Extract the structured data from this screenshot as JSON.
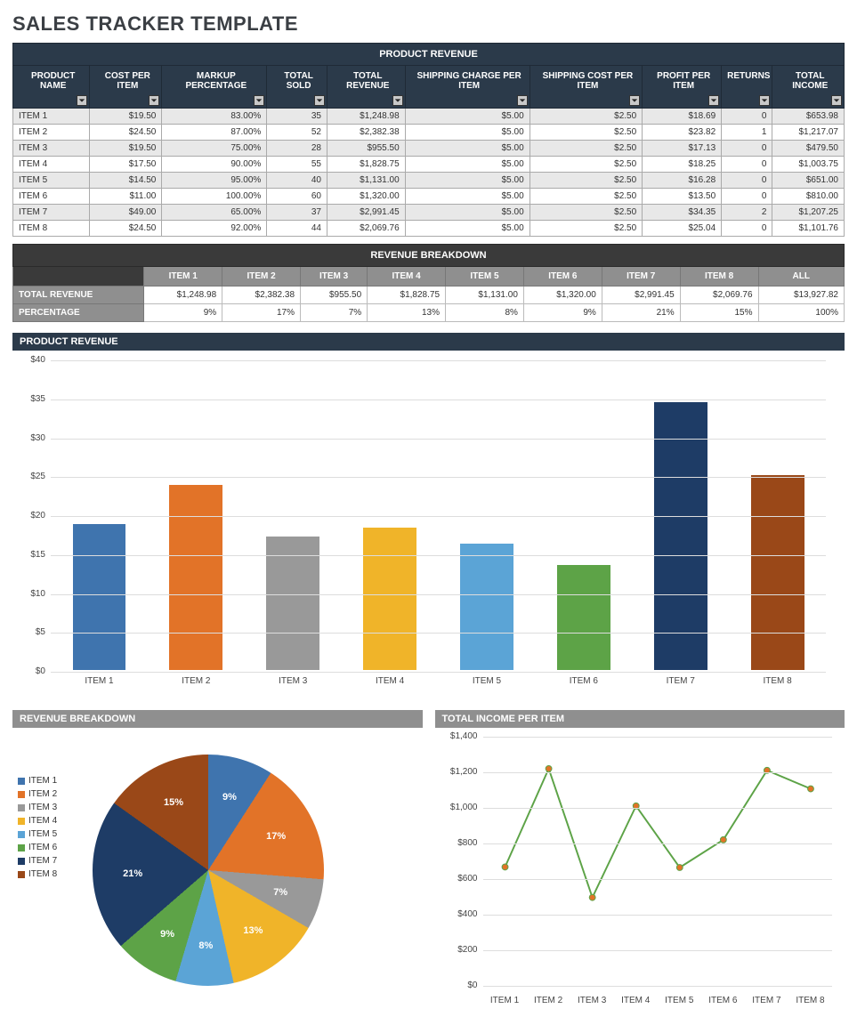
{
  "page_title": "SALES TRACKER TEMPLATE",
  "product_table": {
    "super_header": "PRODUCT REVENUE",
    "columns": [
      "PRODUCT NAME",
      "COST PER ITEM",
      "MARKUP PERCENTAGE",
      "TOTAL SOLD",
      "TOTAL REVENUE",
      "SHIPPING CHARGE PER ITEM",
      "SHIPPING COST PER ITEM",
      "PROFIT PER ITEM",
      "RETURNS",
      "TOTAL INCOME"
    ],
    "rows": [
      {
        "name": "ITEM 1",
        "cost": "$19.50",
        "markup": "83.00%",
        "sold": "35",
        "revenue": "$1,248.98",
        "shipcharge": "$5.00",
        "shipcost": "$2.50",
        "profit": "$18.69",
        "returns": "0",
        "income": "$653.98"
      },
      {
        "name": "ITEM 2",
        "cost": "$24.50",
        "markup": "87.00%",
        "sold": "52",
        "revenue": "$2,382.38",
        "shipcharge": "$5.00",
        "shipcost": "$2.50",
        "profit": "$23.82",
        "returns": "1",
        "income": "$1,217.07"
      },
      {
        "name": "ITEM 3",
        "cost": "$19.50",
        "markup": "75.00%",
        "sold": "28",
        "revenue": "$955.50",
        "shipcharge": "$5.00",
        "shipcost": "$2.50",
        "profit": "$17.13",
        "returns": "0",
        "income": "$479.50"
      },
      {
        "name": "ITEM 4",
        "cost": "$17.50",
        "markup": "90.00%",
        "sold": "55",
        "revenue": "$1,828.75",
        "shipcharge": "$5.00",
        "shipcost": "$2.50",
        "profit": "$18.25",
        "returns": "0",
        "income": "$1,003.75"
      },
      {
        "name": "ITEM 5",
        "cost": "$14.50",
        "markup": "95.00%",
        "sold": "40",
        "revenue": "$1,131.00",
        "shipcharge": "$5.00",
        "shipcost": "$2.50",
        "profit": "$16.28",
        "returns": "0",
        "income": "$651.00"
      },
      {
        "name": "ITEM 6",
        "cost": "$11.00",
        "markup": "100.00%",
        "sold": "60",
        "revenue": "$1,320.00",
        "shipcharge": "$5.00",
        "shipcost": "$2.50",
        "profit": "$13.50",
        "returns": "0",
        "income": "$810.00"
      },
      {
        "name": "ITEM 7",
        "cost": "$49.00",
        "markup": "65.00%",
        "sold": "37",
        "revenue": "$2,991.45",
        "shipcharge": "$5.00",
        "shipcost": "$2.50",
        "profit": "$34.35",
        "returns": "2",
        "income": "$1,207.25"
      },
      {
        "name": "ITEM 8",
        "cost": "$24.50",
        "markup": "92.00%",
        "sold": "44",
        "revenue": "$2,069.76",
        "shipcharge": "$5.00",
        "shipcost": "$2.50",
        "profit": "$25.04",
        "returns": "0",
        "income": "$1,101.76"
      }
    ]
  },
  "breakdown_table": {
    "super_header": "REVENUE BREAKDOWN",
    "columns": [
      "",
      "ITEM 1",
      "ITEM 2",
      "ITEM 3",
      "ITEM 4",
      "ITEM 5",
      "ITEM 6",
      "ITEM 7",
      "ITEM 8",
      "ALL"
    ],
    "rows": [
      {
        "label": "TOTAL REVENUE",
        "cells": [
          "$1,248.98",
          "$2,382.38",
          "$955.50",
          "$1,828.75",
          "$1,131.00",
          "$1,320.00",
          "$2,991.45",
          "$2,069.76",
          "$13,927.82"
        ]
      },
      {
        "label": "PERCENTAGE",
        "cells": [
          "9%",
          "17%",
          "7%",
          "13%",
          "8%",
          "9%",
          "21%",
          "15%",
          "100%"
        ]
      }
    ]
  },
  "bar_chart": {
    "title": "PRODUCT REVENUE",
    "yticks": [
      "$0",
      "$5",
      "$10",
      "$15",
      "$20",
      "$25",
      "$30",
      "$35",
      "$40"
    ],
    "categories": [
      "ITEM 1",
      "ITEM 2",
      "ITEM 3",
      "ITEM 4",
      "ITEM 5",
      "ITEM 6",
      "ITEM 7",
      "ITEM 8"
    ]
  },
  "pie_chart": {
    "title": "REVENUE BREAKDOWN",
    "legend": [
      "ITEM 1",
      "ITEM 2",
      "ITEM 3",
      "ITEM 4",
      "ITEM 5",
      "ITEM 6",
      "ITEM 7",
      "ITEM 8"
    ],
    "labels": [
      "9%",
      "17%",
      "7%",
      "13%",
      "8%",
      "9%",
      "21%",
      "15%"
    ]
  },
  "line_chart": {
    "title": "TOTAL INCOME PER ITEM",
    "yticks": [
      "$0",
      "$200",
      "$400",
      "$600",
      "$800",
      "$1,000",
      "$1,200",
      "$1,400"
    ],
    "categories": [
      "ITEM 1",
      "ITEM 2",
      "ITEM 3",
      "ITEM 4",
      "ITEM 5",
      "ITEM 6",
      "ITEM 7",
      "ITEM 8"
    ]
  },
  "colors": [
    "#3f74ae",
    "#e27328",
    "#999999",
    "#f0b429",
    "#5ba4d6",
    "#5da347",
    "#1e3c66",
    "#9a4818"
  ],
  "chart_data": [
    {
      "type": "bar",
      "title": "PRODUCT REVENUE",
      "xlabel": "",
      "ylabel": "",
      "categories": [
        "ITEM 1",
        "ITEM 2",
        "ITEM 3",
        "ITEM 4",
        "ITEM 5",
        "ITEM 6",
        "ITEM 7",
        "ITEM 8"
      ],
      "values": [
        18.69,
        23.82,
        17.13,
        18.25,
        16.28,
        13.5,
        34.35,
        25.04
      ],
      "ylim": [
        0,
        40
      ],
      "colors": [
        "#3f74ae",
        "#e27328",
        "#999999",
        "#f0b429",
        "#5ba4d6",
        "#5da347",
        "#1e3c66",
        "#9a4818"
      ]
    },
    {
      "type": "pie",
      "title": "REVENUE BREAKDOWN",
      "categories": [
        "ITEM 1",
        "ITEM 2",
        "ITEM 3",
        "ITEM 4",
        "ITEM 5",
        "ITEM 6",
        "ITEM 7",
        "ITEM 8"
      ],
      "values": [
        9,
        17,
        7,
        13,
        8,
        9,
        21,
        15
      ],
      "colors": [
        "#3f74ae",
        "#e27328",
        "#999999",
        "#f0b429",
        "#5ba4d6",
        "#5da347",
        "#1e3c66",
        "#9a4818"
      ]
    },
    {
      "type": "line",
      "title": "TOTAL INCOME PER ITEM",
      "xlabel": "",
      "ylabel": "",
      "categories": [
        "ITEM 1",
        "ITEM 2",
        "ITEM 3",
        "ITEM 4",
        "ITEM 5",
        "ITEM 6",
        "ITEM 7",
        "ITEM 8"
      ],
      "values": [
        653.98,
        1217.07,
        479.5,
        1003.75,
        651.0,
        810.0,
        1207.25,
        1101.76
      ],
      "ylim": [
        0,
        1400
      ],
      "series_color": "#5da347",
      "marker_color": "#e27328"
    }
  ]
}
